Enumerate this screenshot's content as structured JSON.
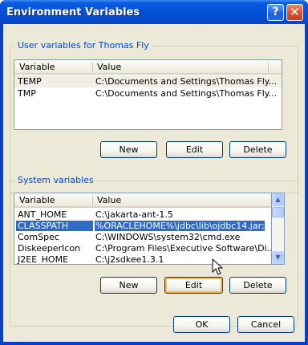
{
  "window": {
    "title": "Environment Variables",
    "help_button": "?",
    "close_button": "✕"
  },
  "user_vars": {
    "group_label": "User variables for Thomas Fly",
    "columns": [
      "Variable",
      "Value"
    ],
    "rows": [
      {
        "variable": "TEMP",
        "value": "C:\\Documents and Settings\\Thomas Fly..."
      },
      {
        "variable": "TMP",
        "value": "C:\\Documents and Settings\\Thomas Fly..."
      }
    ],
    "new_label": "New",
    "edit_label": "Edit",
    "delete_label": "Delete"
  },
  "system_vars": {
    "group_label": "System variables",
    "columns": [
      "Variable",
      "Value"
    ],
    "rows": [
      {
        "variable": "ANT_HOME",
        "value": "C:\\jakarta-ant-1.5"
      },
      {
        "variable": "CLASSPATH",
        "value": "%ORACLEHOME%\\jdbc\\lib\\ojdbc14.jar;..."
      },
      {
        "variable": "ComSpec",
        "value": "C:\\WINDOWS\\system32\\cmd.exe"
      },
      {
        "variable": "DiskeeperIcon",
        "value": "C:\\Program Files\\Executive Software\\Di..."
      },
      {
        "variable": "J2EE_HOME",
        "value": "C:\\j2sdkee1.3.1"
      }
    ],
    "new_label": "New",
    "edit_label": "Edit",
    "delete_label": "Delete"
  },
  "footer": {
    "ok_label": "OK",
    "cancel_label": "Cancel"
  },
  "colors": {
    "title_blue": "#0552d8",
    "group_label": "#0046d5",
    "selection": "#316ac5",
    "dialog_bg": "#ece9d8"
  }
}
